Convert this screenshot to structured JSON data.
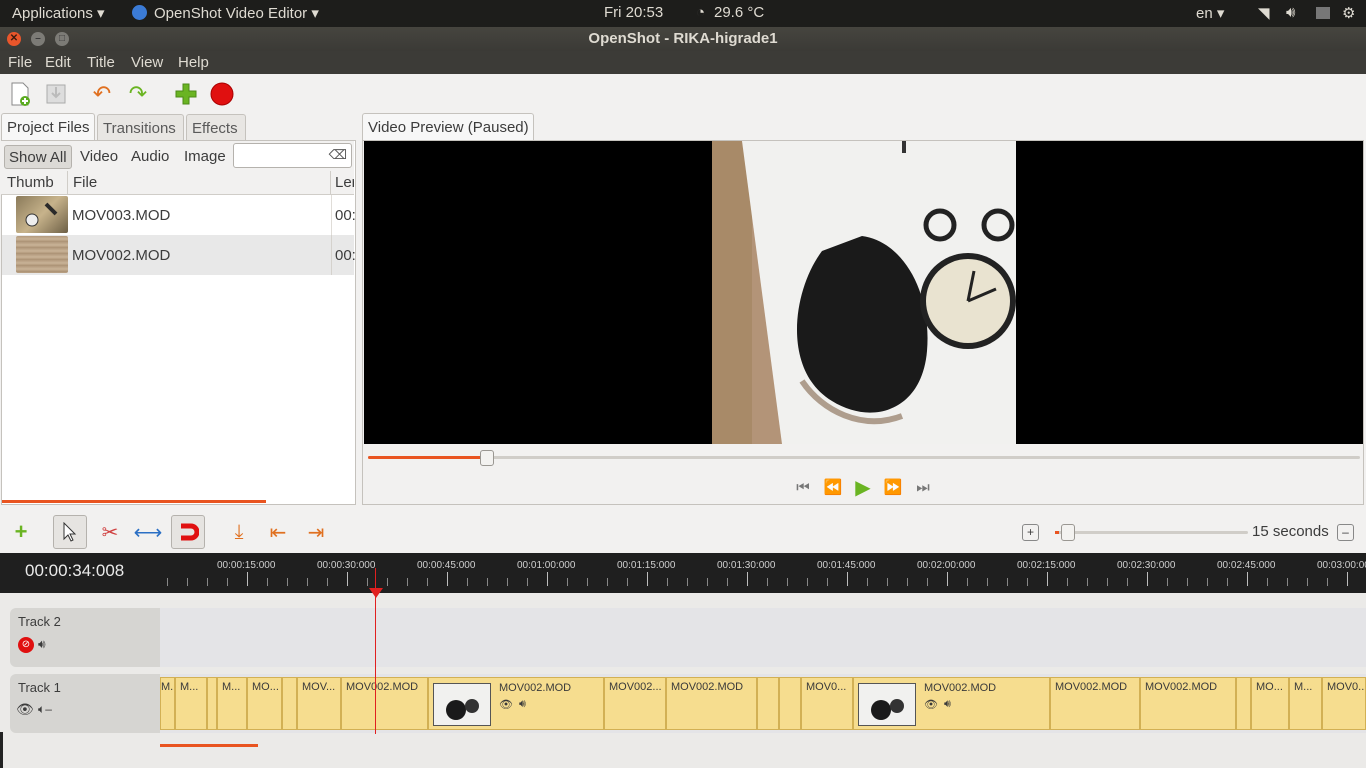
{
  "top_panel": {
    "applications": "Applications ▾",
    "app_name": "OpenShot Video Editor ▾",
    "clock": "Fri 20:53",
    "temperature": "29.6 °C",
    "language": "en ▾"
  },
  "window": {
    "title": "OpenShot - RIKA-higrade1"
  },
  "menu": [
    "File",
    "Edit",
    "Title",
    "View",
    "Help"
  ],
  "left_tabs": [
    "Project Files",
    "Transitions",
    "Effects"
  ],
  "filters": [
    "Show All",
    "Video",
    "Audio",
    "Image"
  ],
  "search": {
    "value": "",
    "clear_icon": "⌫"
  },
  "columns": [
    "Thumb",
    "File",
    "Ler"
  ],
  "files": [
    {
      "name": "MOV003.MOD",
      "length": "00:"
    },
    {
      "name": "MOV002.MOD",
      "length": "00:"
    }
  ],
  "preview": {
    "tab": "Video Preview (Paused)",
    "seek_position": 0.12
  },
  "zoom": {
    "label": "15 seconds",
    "level": 0.02
  },
  "timeline": {
    "timecode": "00:00:34:008",
    "ticks": [
      "00:00:15:000",
      "00:00:30:000",
      "00:00:45:000",
      "00:01:00:000",
      "00:01:15:000",
      "00:01:30:000",
      "00:01:45:000",
      "00:02:00:000",
      "00:02:15:000",
      "00:02:30:000",
      "00:02:45:000",
      "00:03:00:000"
    ],
    "tracks": [
      {
        "name": "Track 2"
      },
      {
        "name": "Track 1"
      }
    ],
    "clips": [
      "M...",
      "M...",
      "M...",
      "MO...",
      "MOV...",
      "MOV002.MOD",
      "MOV002.MOD",
      "MOV002...",
      "MOV002.MOD",
      "MOV0...",
      "MOV002.MOD",
      "MOV002.MOD",
      "MOV002.MOD",
      "MO...",
      "M...",
      "MOV0..."
    ]
  },
  "colors": {
    "accent": "#e95420",
    "clip": "#f6dd8f",
    "playhead": "#e02020"
  }
}
